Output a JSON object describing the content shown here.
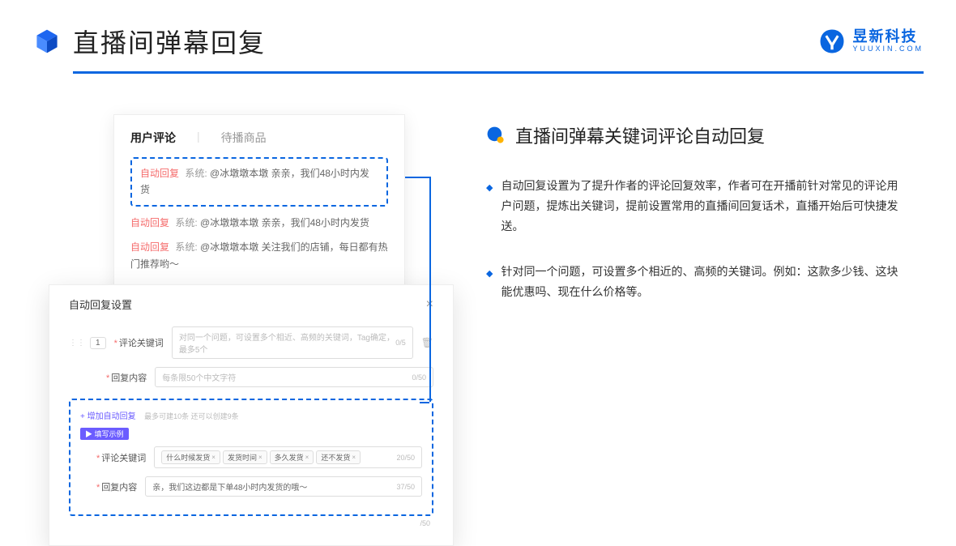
{
  "header": {
    "title": "直播间弹幕回复"
  },
  "logo": {
    "cn": "昱新科技",
    "en": "YUUXIN.COM"
  },
  "comments": {
    "tab1": "用户评论",
    "tab2": "待播商品",
    "c1_tag": "自动回复",
    "c1_sys": "系统:",
    "c1_body": "@冰墩墩本墩 亲亲，我们48小时内发货",
    "c2_tag": "自动回复",
    "c2_sys": "系统:",
    "c2_body": "@冰墩墩本墩 亲亲，我们48小时内发货",
    "c3_tag": "自动回复",
    "c3_sys": "系统:",
    "c3_body": "@冰墩墩本墩 关注我们的店铺，每日都有热门推荐哟～"
  },
  "settings": {
    "title": "自动回复设置",
    "idx": "1",
    "kw_label": "评论关键词",
    "kw_ph": "对同一个问题，可设置多个相近、高频的关键词，Tag确定，最多5个",
    "kw_cnt": "0/5",
    "ct_label": "回复内容",
    "ct_ph": "每条限50个中文字符",
    "ct_cnt": "0/50",
    "add": "+ 增加自动回复",
    "add_hint": "最多可建10条 还可以创建9条",
    "badge": "▶ 填写示例",
    "ex_kw_label": "评论关键词",
    "ex_tags": [
      "什么时候发货",
      "发货时间",
      "多久发货",
      "还不发货"
    ],
    "ex_kw_cnt": "20/50",
    "ex_ct_label": "回复内容",
    "ex_ct_val": "亲，我们这边都是下单48小时内发货的哦～",
    "ex_ct_cnt": "37/50",
    "outer_cnt": "/50"
  },
  "right": {
    "title": "直播间弹幕关键词评论自动回复",
    "b1": "自动回复设置为了提升作者的评论回复效率，作者可在开播前针对常见的评论用户问题，提炼出关键词，提前设置常用的直播间回复话术，直播开始后可快捷发送。",
    "b2": "针对同一个问题，可设置多个相近的、高频的关键词。例如：这款多少钱、这块能优惠吗、现在什么价格等。"
  }
}
